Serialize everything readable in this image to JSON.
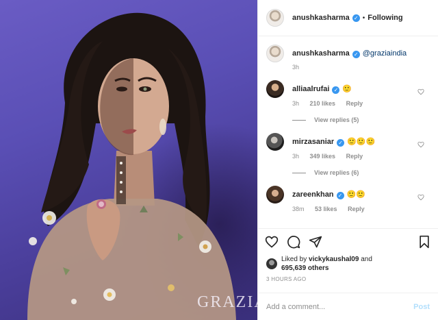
{
  "photo": {
    "watermark": "GRAZIA"
  },
  "header": {
    "username": "anushkasharma",
    "verified_mark": "✓",
    "separator": "•",
    "follow_status": "Following"
  },
  "caption": {
    "username": "anushkasharma",
    "verified_mark": "✓",
    "mention": "@graziaindia",
    "time": "3h"
  },
  "comments": [
    {
      "username": "alliaalrufai",
      "verified_mark": "✓",
      "text": "🙂",
      "time": "3h",
      "likes": "210 likes",
      "reply": "Reply",
      "view_replies": "View replies (5)"
    },
    {
      "username": "mirzasaniar",
      "verified_mark": "✓",
      "text": "🙂🙂🙂",
      "time": "3h",
      "likes": "349 likes",
      "reply": "Reply",
      "view_replies": "View replies (6)"
    },
    {
      "username": "zareenkhan",
      "verified_mark": "✓",
      "text": "🙂🙂",
      "time": "38m",
      "likes": "53 likes",
      "reply": "Reply"
    }
  ],
  "actions": {
    "icons": [
      "heart-icon",
      "comment-icon",
      "share-icon",
      "bookmark-icon"
    ]
  },
  "likes": {
    "prefix": "Liked by",
    "user": "vickykaushal09",
    "conjunction": "and",
    "others": "695,639 others"
  },
  "timestamp": "3 HOURS AGO",
  "add_comment": {
    "placeholder": "Add a comment...",
    "post_label": "Post"
  },
  "colors": {
    "accent_blue": "#3897f0",
    "post_disabled": "#b2dffc",
    "secondary_text": "#8e8e8e",
    "mention_link": "#003569",
    "photo_background": "#5a4fb5"
  }
}
